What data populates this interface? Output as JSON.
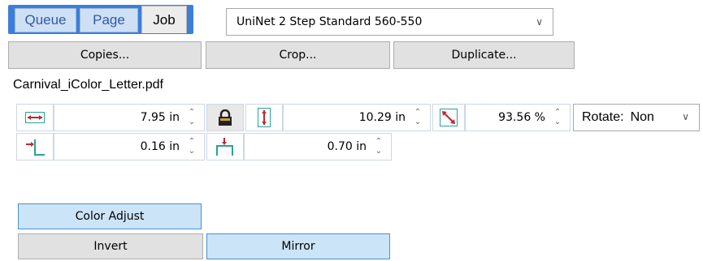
{
  "tabs": [
    {
      "label": "Queue"
    },
    {
      "label": "Page"
    },
    {
      "label": "Job"
    }
  ],
  "printer_select": {
    "value": "UniNet 2 Step Standard 560-550"
  },
  "toolbar": {
    "copies": "Copies...",
    "crop": "Crop...",
    "duplicate": "Duplicate..."
  },
  "file": {
    "name": "Carnival_iColor_Letter.pdf"
  },
  "size": {
    "width": "7.95 in",
    "height": "10.29 in",
    "scale": "93.56 %"
  },
  "rotate": {
    "label": "Rotate:",
    "value": "Non"
  },
  "offset": {
    "left": "0.16 in",
    "top": "0.70 in"
  },
  "buttons": {
    "color_adjust": "Color Adjust",
    "invert": "Invert",
    "mirror": "Mirror"
  },
  "colors": {
    "tab_blue": "#3c7fd8",
    "icon_red": "#c0272d",
    "icon_teal": "#2aa198",
    "btn_blue": "#cce4f7"
  }
}
